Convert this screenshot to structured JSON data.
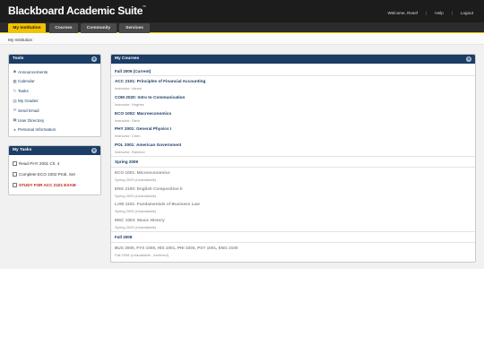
{
  "app": {
    "title": "Blackboard Academic Suite",
    "trademark": "™"
  },
  "user_links": [
    "Welcome, Rosef",
    "Help",
    "Logout"
  ],
  "tabs": [
    {
      "label": "My Institution",
      "active": true
    },
    {
      "label": "Courses",
      "active": false
    },
    {
      "label": "Community",
      "active": false
    },
    {
      "label": "Services",
      "active": false
    }
  ],
  "breadcrumb": "My Institution",
  "tools": {
    "title": "Tools",
    "items": [
      {
        "label": "Announcements",
        "icon": "megaphone-icon"
      },
      {
        "label": "Calendar",
        "icon": "calendar-icon"
      },
      {
        "label": "Tasks",
        "icon": "notepad-icon"
      },
      {
        "label": "My Grades",
        "icon": "grades-icon"
      },
      {
        "label": "Send Email",
        "icon": "email-icon"
      },
      {
        "label": "User Directory",
        "icon": "directory-icon"
      },
      {
        "label": "Personal Information",
        "icon": "person-icon"
      }
    ]
  },
  "tasks": {
    "title": "My Tasks",
    "items": [
      {
        "label": "Read PHY 2001 Ch. 4",
        "urgent": false
      },
      {
        "label": "Complete ECO 1002 Prob. Set",
        "urgent": false
      },
      {
        "label": "STUDY FOR ACC 2101 EXAM",
        "urgent": true
      }
    ]
  },
  "courses": {
    "title": "My Courses",
    "sections": [
      {
        "heading": "Fall 2009 (Current)",
        "courses": [
          {
            "name": "ACC 2101: Principles of Financial Accounting",
            "sub": "Instructor: Vance"
          },
          {
            "name": "COM 2020: Intro to Communication",
            "sub": "Instructor: Hughes"
          },
          {
            "name": "ECO 1002: Macroeconomics",
            "sub": "Instructor: Stein"
          },
          {
            "name": "PHY 2001: General Physics I",
            "sub": "Instructor: Chen"
          },
          {
            "name": "POL 2001: American Government",
            "sub": "Instructor: Ramirez"
          }
        ]
      },
      {
        "heading": "Spring 2009",
        "courses": [
          {
            "name": "ECO 1001: Microeconomics",
            "sub": "Spring 2009 (Unavailable)"
          },
          {
            "name": "ENG 2100: English Composition II",
            "sub": "Spring 2009 (Unavailable)"
          },
          {
            "name": "LAW 1101: Fundamentals of Business Law",
            "sub": "Spring 2009 (Unavailable)"
          },
          {
            "name": "MSC 1003: Music History",
            "sub": "Spring 2009 (Unavailable)"
          }
        ]
      },
      {
        "heading": "Fall 2008",
        "courses": [
          {
            "name": "BUS 2000, FYS 1000, HIS 1001, PHI 1000, PSY 1001, ENG 2100",
            "sub": "Fall 2008 (Unavailable - Archived)"
          }
        ]
      }
    ]
  },
  "colors": {
    "header": "#1c1c1c",
    "accent": "#f2c200",
    "panel_head": "#1b3d66",
    "urgent": "#c0201a"
  }
}
